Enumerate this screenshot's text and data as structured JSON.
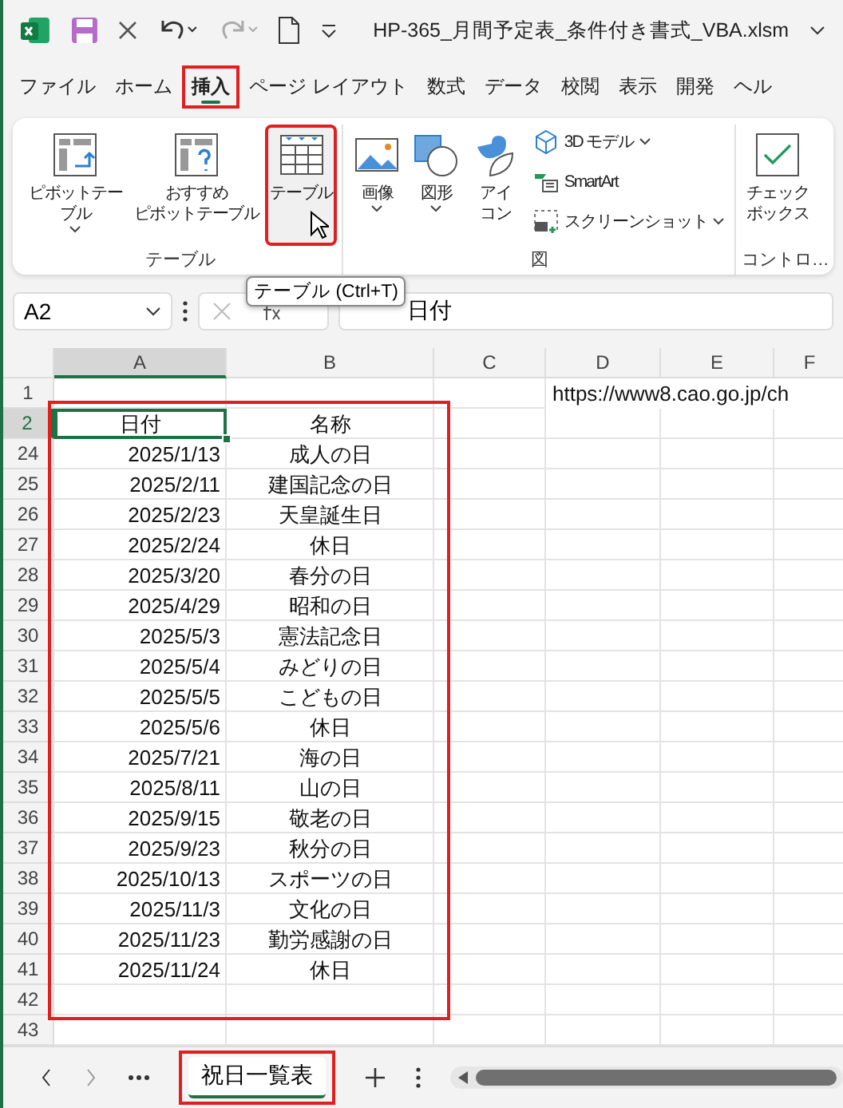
{
  "title_bar": {
    "file_name": "HP-365_月間予定表_条件付き書式_VBA.xlsm"
  },
  "menu_tabs": [
    {
      "label": "ファイル",
      "selected": false,
      "highlighted": false
    },
    {
      "label": "ホーム",
      "selected": false,
      "highlighted": false
    },
    {
      "label": "挿入",
      "selected": true,
      "highlighted": true
    },
    {
      "label": "ページ レイアウト",
      "selected": false,
      "highlighted": false
    },
    {
      "label": "数式",
      "selected": false,
      "highlighted": false
    },
    {
      "label": "データ",
      "selected": false,
      "highlighted": false
    },
    {
      "label": "校閲",
      "selected": false,
      "highlighted": false
    },
    {
      "label": "表示",
      "selected": false,
      "highlighted": false
    },
    {
      "label": "開発",
      "selected": false,
      "highlighted": false
    },
    {
      "label": "ヘル",
      "selected": false,
      "highlighted": false
    }
  ],
  "ribbon": [
    {
      "label": "テーブル",
      "items": [
        {
          "kind": "large",
          "lines": [
            "ピボットテー",
            "ブル"
          ],
          "dropdown": true,
          "highlighted": false,
          "hovered": false
        },
        {
          "kind": "large",
          "lines": [
            "おすすめ",
            "ピボットテーブル"
          ],
          "dropdown": false,
          "highlighted": false,
          "hovered": false
        },
        {
          "kind": "large",
          "lines": [
            "テーブル"
          ],
          "dropdown": false,
          "highlighted": true,
          "hovered": true
        }
      ]
    },
    {
      "label": "図",
      "items": [
        {
          "kind": "large",
          "lines": [
            "画像"
          ],
          "dropdown": true,
          "highlighted": false,
          "hovered": false
        },
        {
          "kind": "large",
          "lines": [
            "図形"
          ],
          "dropdown": true,
          "highlighted": false,
          "hovered": false
        },
        {
          "kind": "large",
          "lines": [
            "アイ",
            "コン"
          ],
          "dropdown": false,
          "highlighted": false,
          "hovered": false
        },
        {
          "kind": "small",
          "lines": [
            "3D モデル"
          ],
          "dropdown": true,
          "highlighted": false,
          "hovered": false
        },
        {
          "kind": "small",
          "lines": [
            "SmartArt"
          ],
          "dropdown": false,
          "highlighted": false,
          "hovered": false
        },
        {
          "kind": "small",
          "lines": [
            "スクリーンショット"
          ],
          "dropdown": true,
          "highlighted": false,
          "hovered": false
        }
      ]
    },
    {
      "label": "コントロ…",
      "items": [
        {
          "kind": "large",
          "lines": [
            "チェック",
            "ボックス"
          ],
          "dropdown": false,
          "highlighted": false,
          "hovered": false
        }
      ]
    }
  ],
  "tooltip": "テーブル (Ctrl+T)",
  "formula_bar": {
    "name_box": "A2",
    "value": "日付"
  },
  "columns": [
    "A",
    "B",
    "C",
    "D",
    "E",
    "F"
  ],
  "rows": [
    {
      "number": "1",
      "selected": false,
      "note": "https://www8.cao.go.jp/ch"
    },
    {
      "number": "2",
      "selected": true,
      "date": "日付",
      "name": "名称",
      "kind": "header"
    },
    {
      "number": "24",
      "selected": false,
      "date": "2025/1/13",
      "name": "成人の日"
    },
    {
      "number": "25",
      "selected": false,
      "date": "2025/2/11",
      "name": "建国記念の日"
    },
    {
      "number": "26",
      "selected": false,
      "date": "2025/2/23",
      "name": "天皇誕生日"
    },
    {
      "number": "27",
      "selected": false,
      "date": "2025/2/24",
      "name": "休日"
    },
    {
      "number": "28",
      "selected": false,
      "date": "2025/3/20",
      "name": "春分の日"
    },
    {
      "number": "29",
      "selected": false,
      "date": "2025/4/29",
      "name": "昭和の日"
    },
    {
      "number": "30",
      "selected": false,
      "date": "2025/5/3",
      "name": "憲法記念日"
    },
    {
      "number": "31",
      "selected": false,
      "date": "2025/5/4",
      "name": "みどりの日"
    },
    {
      "number": "32",
      "selected": false,
      "date": "2025/5/5",
      "name": "こどもの日"
    },
    {
      "number": "33",
      "selected": false,
      "date": "2025/5/6",
      "name": "休日"
    },
    {
      "number": "34",
      "selected": false,
      "date": "2025/7/21",
      "name": "海の日"
    },
    {
      "number": "35",
      "selected": false,
      "date": "2025/8/11",
      "name": "山の日"
    },
    {
      "number": "36",
      "selected": false,
      "date": "2025/9/15",
      "name": "敬老の日"
    },
    {
      "number": "37",
      "selected": false,
      "date": "2025/9/23",
      "name": "秋分の日"
    },
    {
      "number": "38",
      "selected": false,
      "date": "2025/10/13",
      "name": "スポーツの日"
    },
    {
      "number": "39",
      "selected": false,
      "date": "2025/11/3",
      "name": "文化の日"
    },
    {
      "number": "40",
      "selected": false,
      "date": "2025/11/23",
      "name": "勤労感謝の日"
    },
    {
      "number": "41",
      "selected": false,
      "date": "2025/11/24",
      "name": "休日"
    },
    {
      "number": "42",
      "selected": false
    },
    {
      "number": "43",
      "selected": false
    }
  ],
  "data_highlighted": true,
  "sheet_tabs": [
    {
      "label": "祝日一覧表",
      "selected": true,
      "highlighted": true
    }
  ]
}
